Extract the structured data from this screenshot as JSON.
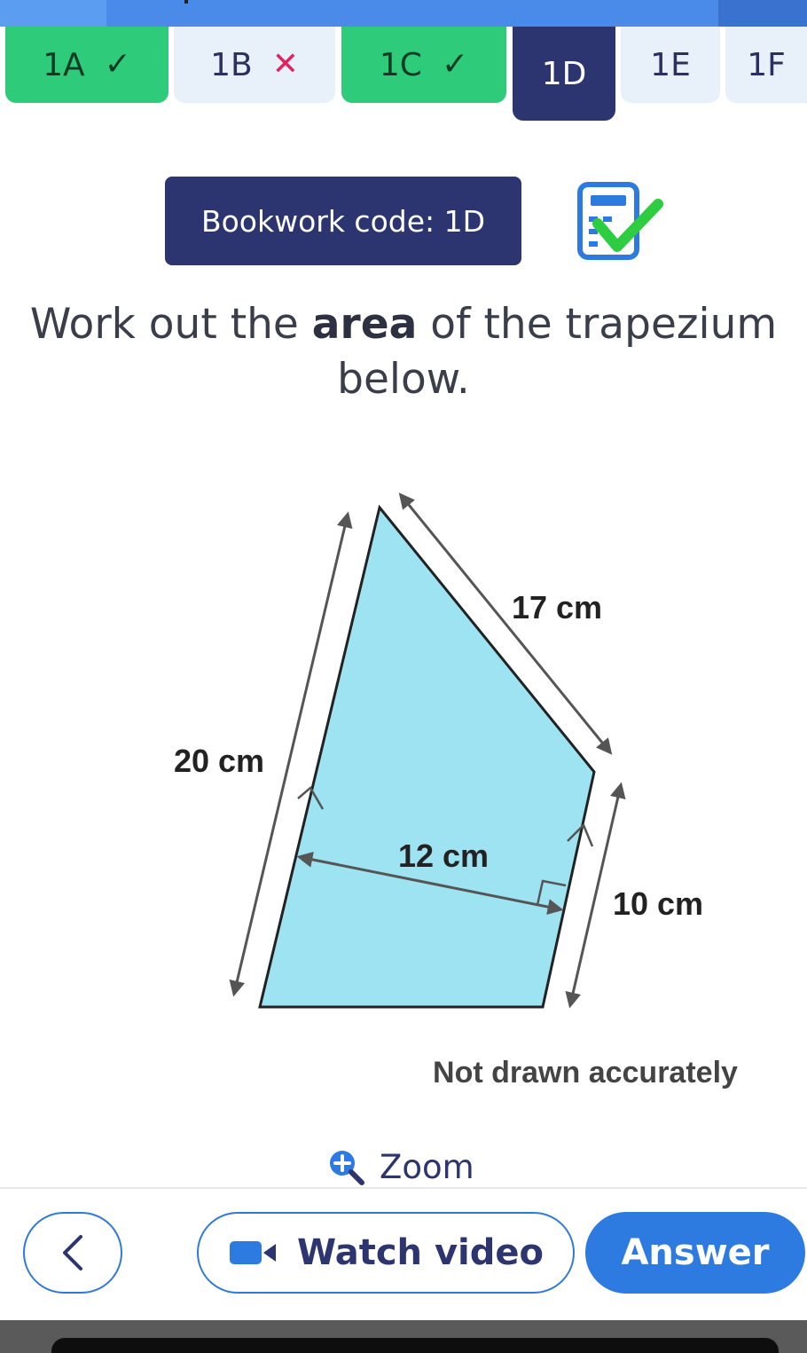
{
  "progress": {
    "segments": 3
  },
  "tabs": [
    {
      "label": "1A",
      "status": "correct",
      "mark": "✓"
    },
    {
      "label": "1B",
      "status": "incorrect",
      "mark": "✕"
    },
    {
      "label": "1C",
      "status": "correct",
      "mark": "✓"
    },
    {
      "label": "1D",
      "status": "active",
      "mark": ""
    },
    {
      "label": "1E",
      "status": "pending",
      "mark": ""
    },
    {
      "label": "1F",
      "status": "pending",
      "mark": ""
    }
  ],
  "bookwork": {
    "label": "Bookwork code: 1D"
  },
  "calculator": {
    "icon": "calculator-allowed-icon",
    "check_color": "#2ecc40"
  },
  "question": {
    "line1_pre": "Work out the ",
    "line1_bold": "area",
    "line1_post": " of the trapezium",
    "line2": "below."
  },
  "diagram": {
    "shape": "trapezium",
    "fill_color": "#9de3f1",
    "labels": {
      "top_side": "17 cm",
      "left_side": "20 cm",
      "height": "12 cm",
      "right_side": "10 cm"
    },
    "note": "Not drawn accurately"
  },
  "zoom": {
    "label": "Zoom",
    "icon": "zoom-in-icon"
  },
  "buttons": {
    "back_icon": "chevron-left-icon",
    "watch_video": "Watch video",
    "video_icon": "video-camera-icon",
    "answer": "Answer"
  },
  "colors": {
    "accent": "#2d7ae0",
    "navy": "#2c3570",
    "correct": "#2ecc7a",
    "incorrect": "#e0245e"
  }
}
